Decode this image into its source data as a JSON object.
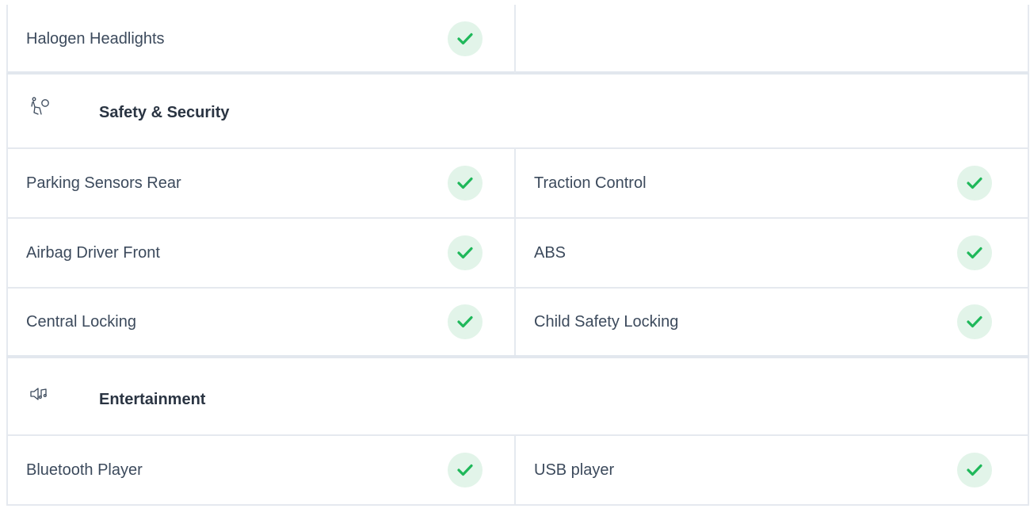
{
  "colors": {
    "check_bg": "#e2f4e9",
    "check_mark": "#1fb85a",
    "border": "#e5e9ef",
    "text": "#3c4a5c"
  },
  "top_row": {
    "left_label": "Halogen Headlights",
    "left_checked": true
  },
  "sections": [
    {
      "title": "Safety & Security",
      "icon": "seated-person-airbag-icon",
      "rows": [
        {
          "left": "Parking Sensors Rear",
          "right": "Traction Control"
        },
        {
          "left": "Airbag Driver Front",
          "right": "ABS"
        },
        {
          "left": "Central Locking",
          "right": "Child Safety Locking"
        }
      ]
    },
    {
      "title": "Entertainment",
      "icon": "speaker-music-icon",
      "rows": [
        {
          "left": "Bluetooth Player",
          "right": "USB player"
        }
      ]
    }
  ]
}
